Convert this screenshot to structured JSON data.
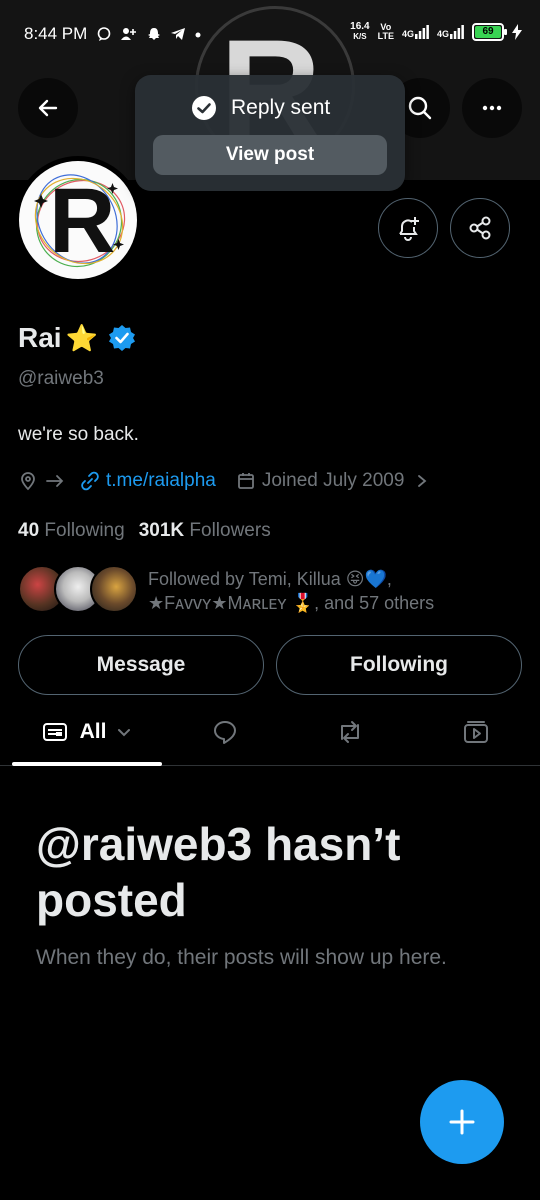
{
  "status_bar": {
    "time": "8:44 PM",
    "speed_value": "16.4",
    "speed_unit": "K/S",
    "volte_top": "Vo",
    "volte_bottom": "LTE",
    "net1": "4G",
    "net2": "4G",
    "battery": "69"
  },
  "header": {
    "back_icon": "arrow-left-icon",
    "search_icon": "search-icon",
    "more_icon": "more-horizontal-icon",
    "banner_letter": "R"
  },
  "toast": {
    "title": "Reply sent",
    "button_label": "View post"
  },
  "profile": {
    "avatar_letter": "R",
    "name": "Rai",
    "name_emoji": "⭐",
    "handle": "@raiweb3",
    "bio": "we're so back.",
    "link": "t.me/raialpha",
    "joined": "Joined July 2009",
    "following_count": "40",
    "following_label": "Following",
    "followers_count": "301K",
    "followers_label": "Followers",
    "followed_by_line1": "Followed by Temi, Killua 😝💙,",
    "followed_by_line2": "★Fᴀᴠᴠʏ★Mᴀʀʟᴇʏ 🎖️, and 57 others"
  },
  "actions": {
    "message_label": "Message",
    "following_label": "Following"
  },
  "tabs": {
    "all_label": "All"
  },
  "empty_state": {
    "title": "@raiweb3 hasn’t posted",
    "subtitle": "When they do, their posts will show up here."
  },
  "colors": {
    "accent": "#1d9bf0",
    "muted": "#71767b",
    "text": "#e7e9ea",
    "battery": "#39d353"
  }
}
